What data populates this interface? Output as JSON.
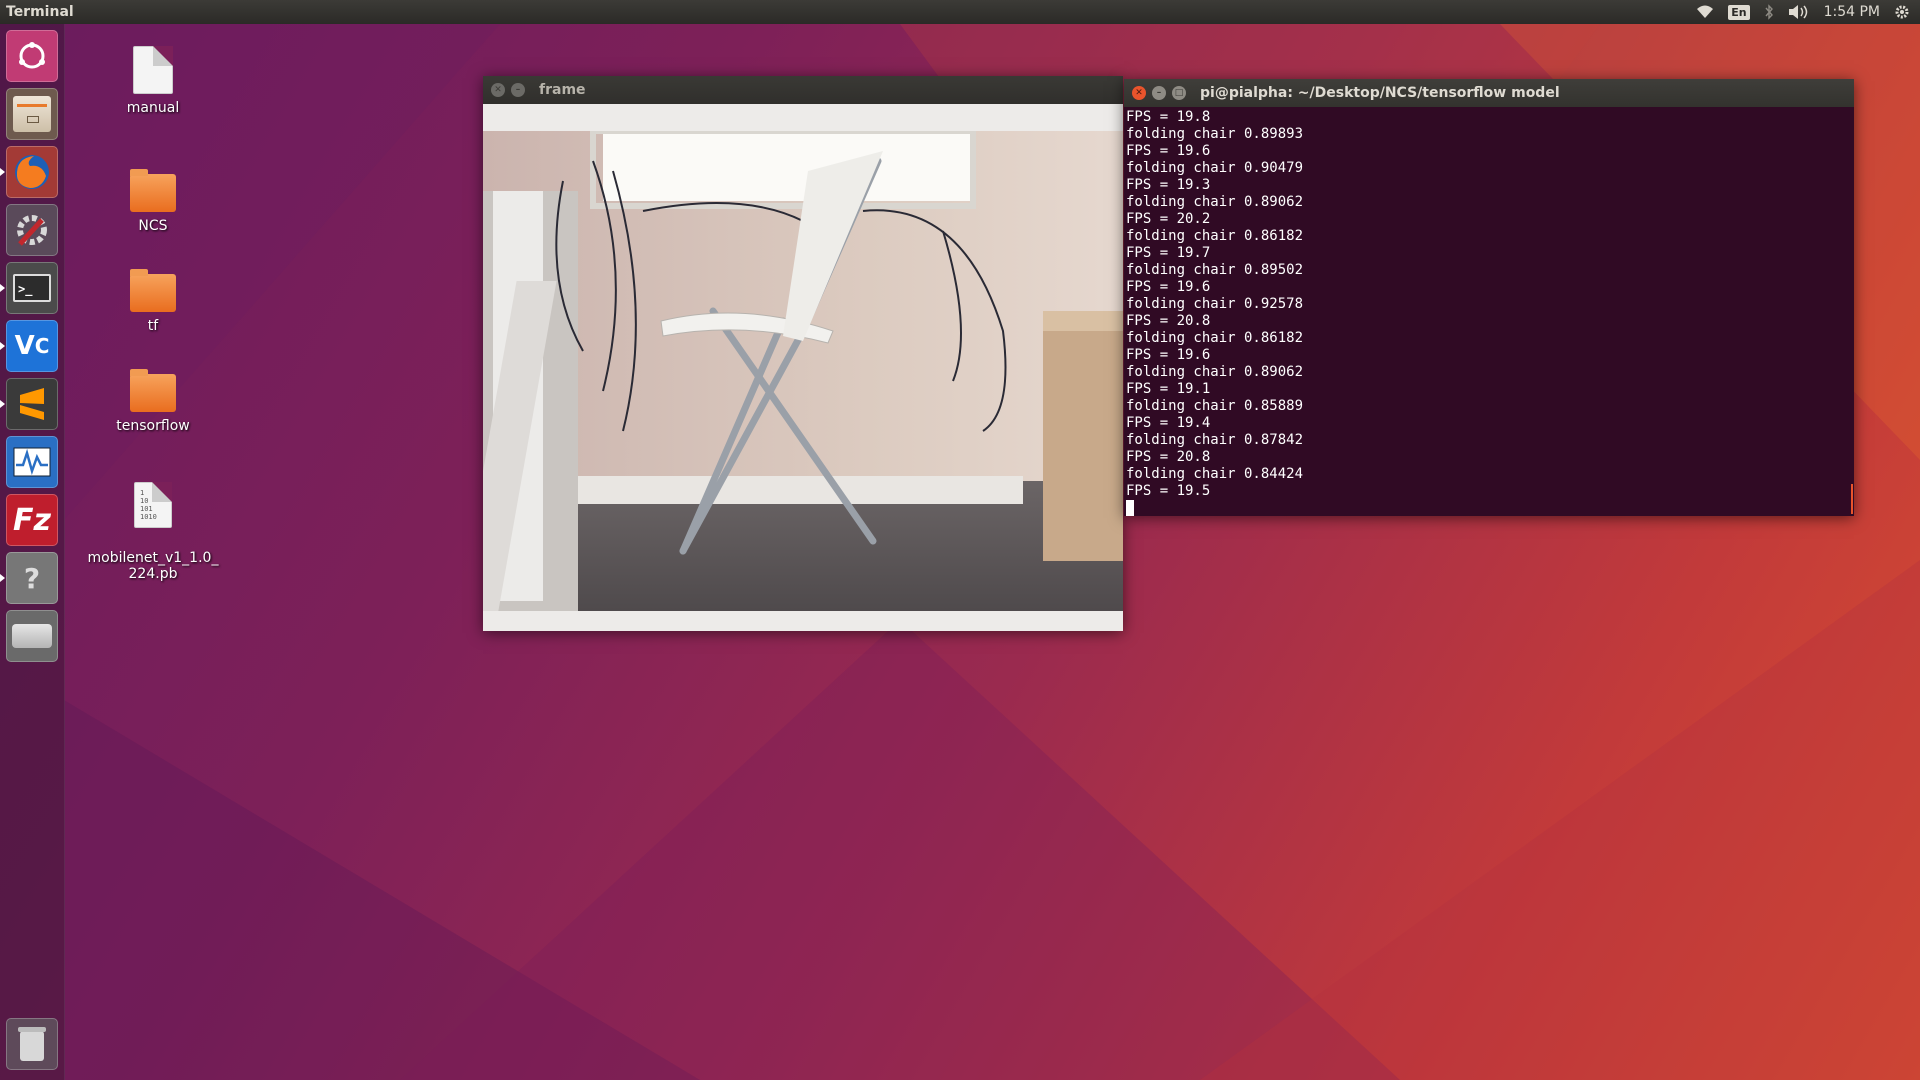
{
  "top_panel": {
    "app_title": "Terminal",
    "language": "En",
    "clock": "1:54 PM",
    "icons": [
      "wifi-icon",
      "keyboard-language-icon",
      "bluetooth-icon",
      "volume-icon",
      "clock",
      "settings-gear-icon"
    ]
  },
  "launcher": {
    "items": [
      {
        "name": "ubuntu-dash-icon",
        "label": "Search your computer",
        "color": "#e95420"
      },
      {
        "name": "files-icon",
        "label": "Files",
        "color": "#c9b89e"
      },
      {
        "name": "firefox-icon",
        "label": "Firefox",
        "color": "#e66000"
      },
      {
        "name": "system-settings-icon",
        "label": "System Settings",
        "color": "#c9402f"
      },
      {
        "name": "terminal-icon",
        "label": "Terminal",
        "color": "#2c2c2c"
      },
      {
        "name": "vnc-viewer-icon",
        "label": "VNC Viewer",
        "color": "#1e73d8"
      },
      {
        "name": "sublime-text-icon",
        "label": "Sublime Text",
        "color": "#3a3a3a"
      },
      {
        "name": "system-monitor-icon",
        "label": "System Monitor",
        "color": "#2a6fc4"
      },
      {
        "name": "filezilla-icon",
        "label": "FileZilla",
        "color": "#bf1e2d"
      },
      {
        "name": "help-icon",
        "label": "Help",
        "color": "#8a8a8a"
      },
      {
        "name": "drive-icon",
        "label": "Drive",
        "color": "#b5b5b5"
      },
      {
        "name": "trash-icon",
        "label": "Trash",
        "color": "#9a9a9a"
      }
    ]
  },
  "desktop": {
    "icons": [
      {
        "label": "manual",
        "kind": "document"
      },
      {
        "label": "NCS",
        "kind": "folder"
      },
      {
        "label": "tf",
        "kind": "folder"
      },
      {
        "label": "tensorflow",
        "kind": "folder"
      },
      {
        "label": "mobilenet_v1_1.0_\n224.pb",
        "kind": "binary-file"
      }
    ]
  },
  "frame_window": {
    "title": "frame"
  },
  "terminal_window": {
    "title": "pi@pialpha: ~/Desktop/NCS/tensorflow model",
    "lines": [
      "FPS = 19.8",
      "folding chair 0.89893",
      "FPS = 19.6",
      "folding chair 0.90479",
      "FPS = 19.3",
      "folding chair 0.89062",
      "FPS = 20.2",
      "folding chair 0.86182",
      "FPS = 19.7",
      "folding chair 0.89502",
      "FPS = 19.6",
      "folding chair 0.92578",
      "FPS = 20.8",
      "folding chair 0.86182",
      "FPS = 19.6",
      "folding chair 0.89062",
      "FPS = 19.1",
      "folding chair 0.85889",
      "FPS = 19.4",
      "folding chair 0.87842",
      "FPS = 20.8",
      "folding chair 0.84424",
      "FPS = 19.5"
    ]
  },
  "colors": {
    "terminal_bg": "#300a24",
    "panel_bg": "#3c3b37",
    "close_button": "#e9542c"
  }
}
